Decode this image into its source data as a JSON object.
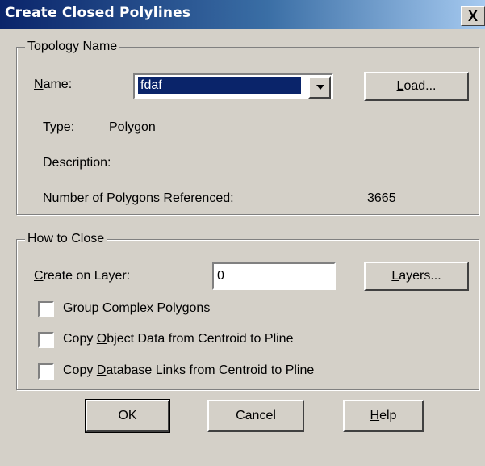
{
  "window": {
    "title": "Create Closed Polylines",
    "close_glyph": "X"
  },
  "topology_group": {
    "legend": "Topology Name",
    "name_label_prefix": "",
    "name_label_accel": "N",
    "name_label_rest": "ame:",
    "name_value": "fdaf",
    "load_button_accel": "L",
    "load_button_rest": "oad...",
    "type_label": "Type:",
    "type_value": "Polygon",
    "description_label": "Description:",
    "polygons_label": "Number of Polygons Referenced:",
    "polygons_value": "3665"
  },
  "close_group": {
    "legend": "How to Close",
    "layer_label_accel": "C",
    "layer_label_rest": "reate on Layer:",
    "layer_value": "0",
    "layers_button_accel": "L",
    "layers_button_rest": "ayers...",
    "check_group_accel": "G",
    "check_group_rest": "roup Complex Polygons",
    "check_objdata_pre": "Copy ",
    "check_objdata_accel": "O",
    "check_objdata_rest": "bject Data from Centroid to Pline",
    "check_dblinks_pre": "Copy ",
    "check_dblinks_accel": "D",
    "check_dblinks_rest": "atabase Links from Centroid to Pline"
  },
  "buttons": {
    "ok": "OK",
    "cancel": "Cancel",
    "help_accel": "H",
    "help_rest": "elp"
  },
  "icons": {
    "dropdown": "chevron-down-icon",
    "close": "close-icon"
  }
}
